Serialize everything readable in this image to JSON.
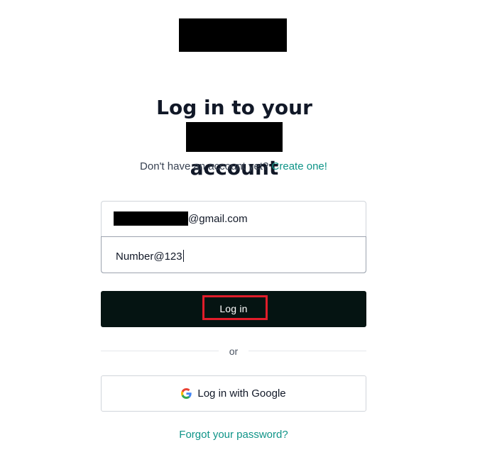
{
  "heading": {
    "line1": "Log in to your",
    "line2": "account"
  },
  "signup_prompt": {
    "text": "Don't have an account yet?",
    "link_label": "Create one!"
  },
  "form": {
    "email_suffix": "@gmail.com",
    "password_value": "Number@123",
    "login_label": "Log in"
  },
  "divider_text": "or",
  "google_login_label": "Log in with Google",
  "forgot_password_label": "Forgot your password?",
  "colors": {
    "accent": "#0f9488",
    "button_bg": "#051412",
    "highlight_border": "#e11d2a"
  },
  "icons": {
    "google": "google-g-icon"
  }
}
